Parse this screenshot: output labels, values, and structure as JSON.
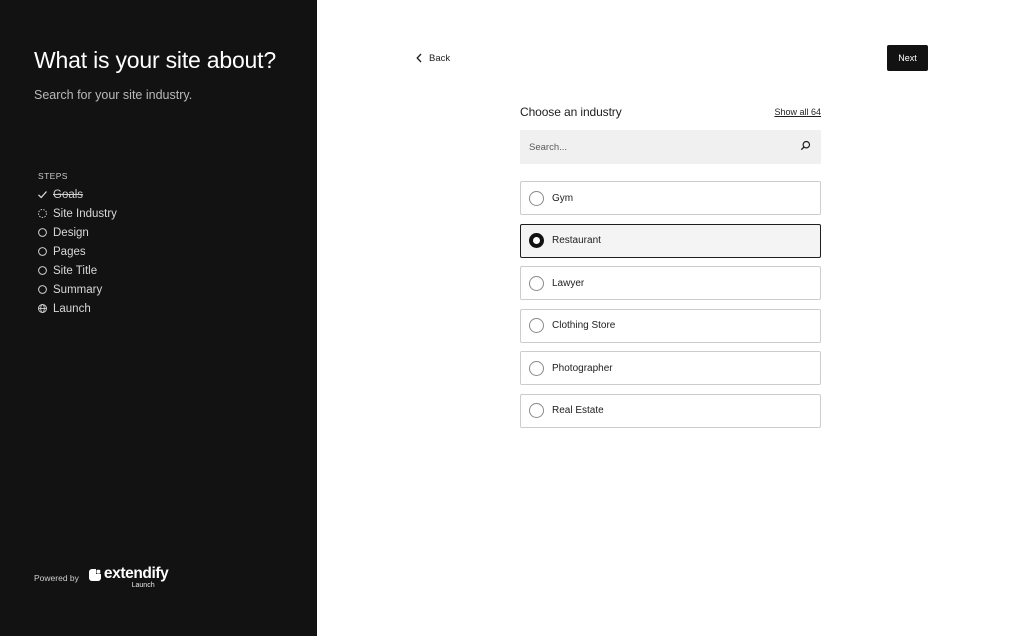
{
  "sidebar": {
    "title": "What is your site about?",
    "subtitle": "Search for your site industry.",
    "steps_heading": "STEPS",
    "steps": [
      {
        "label": "Goals",
        "status": "done",
        "icon": "check-icon"
      },
      {
        "label": "Site Industry",
        "status": "current",
        "icon": "dotted-circle-icon"
      },
      {
        "label": "Design",
        "status": "pending",
        "icon": "circle-icon"
      },
      {
        "label": "Pages",
        "status": "pending",
        "icon": "circle-icon"
      },
      {
        "label": "Site Title",
        "status": "pending",
        "icon": "circle-icon"
      },
      {
        "label": "Summary",
        "status": "pending",
        "icon": "circle-icon"
      },
      {
        "label": "Launch",
        "status": "pending",
        "icon": "globe-icon"
      }
    ],
    "powered_by": "Powered by",
    "brand_name": "extendify",
    "brand_sub": "Launch"
  },
  "nav": {
    "back_label": "Back",
    "next_label": "Next"
  },
  "industry": {
    "title": "Choose an industry",
    "show_all_label": "Show all 64",
    "search_placeholder": "Search...",
    "options": [
      {
        "label": "Gym",
        "selected": false
      },
      {
        "label": "Restaurant",
        "selected": true
      },
      {
        "label": "Lawyer",
        "selected": false
      },
      {
        "label": "Clothing Store",
        "selected": false
      },
      {
        "label": "Photographer",
        "selected": false
      },
      {
        "label": "Real Estate",
        "selected": false
      }
    ]
  },
  "colors": {
    "sidebar_bg": "#121212",
    "primary_button_bg": "#121212",
    "search_bg": "#f0f0f0",
    "selected_option_bg": "#f4f4f4"
  }
}
